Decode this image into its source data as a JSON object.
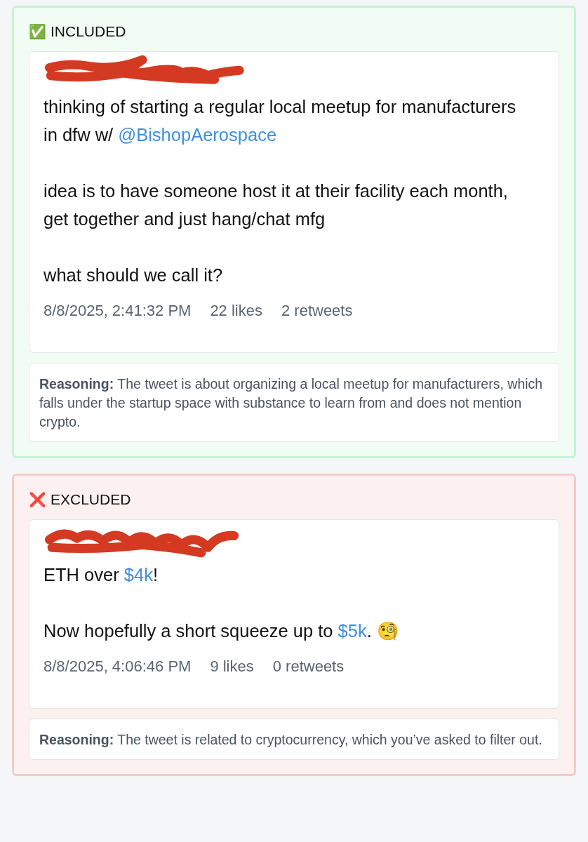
{
  "sections": [
    {
      "kind": "included",
      "icon": "✅",
      "label": "INCLUDED",
      "tweet": {
        "paragraphs": [
          [
            {
              "text": "thinking of starting a regular local meetup for manufacturers in dfw w/ ",
              "link": false
            },
            {
              "text": "@BishopAerospace",
              "link": true
            }
          ],
          [
            {
              "text": "idea is to have someone host it at their facility each month, get together and just hang/chat mfg",
              "link": false
            }
          ],
          [
            {
              "text": "what should we call it?",
              "link": false
            }
          ]
        ],
        "time": "8/8/2025, 2:41:32 PM",
        "likes": "22 likes",
        "retweets": "2 retweets"
      },
      "reasoning": "**Reasoning:** The tweet is about organizing a local meetup for manufacturers, which falls under the startup space with substance to learn from and does not mention crypto."
    },
    {
      "kind": "excluded",
      "icon": "❌",
      "label": "EXCLUDED",
      "tweet": {
        "paragraphs": [
          [
            {
              "text": "ETH over ",
              "link": false
            },
            {
              "text": "$4k",
              "link": true
            },
            {
              "text": "!",
              "link": false
            }
          ],
          [
            {
              "text": "Now hopefully a short squeeze up to ",
              "link": false
            },
            {
              "text": "$5k",
              "link": true
            },
            {
              "text": ". 🧐",
              "link": false
            }
          ]
        ],
        "time": "8/8/2025, 4:06:46 PM",
        "likes": "9 likes",
        "retweets": "0 retweets"
      },
      "reasoning": "**Reasoning:** The tweet is related to cryptocurrency, which you’ve asked to filter out."
    }
  ]
}
